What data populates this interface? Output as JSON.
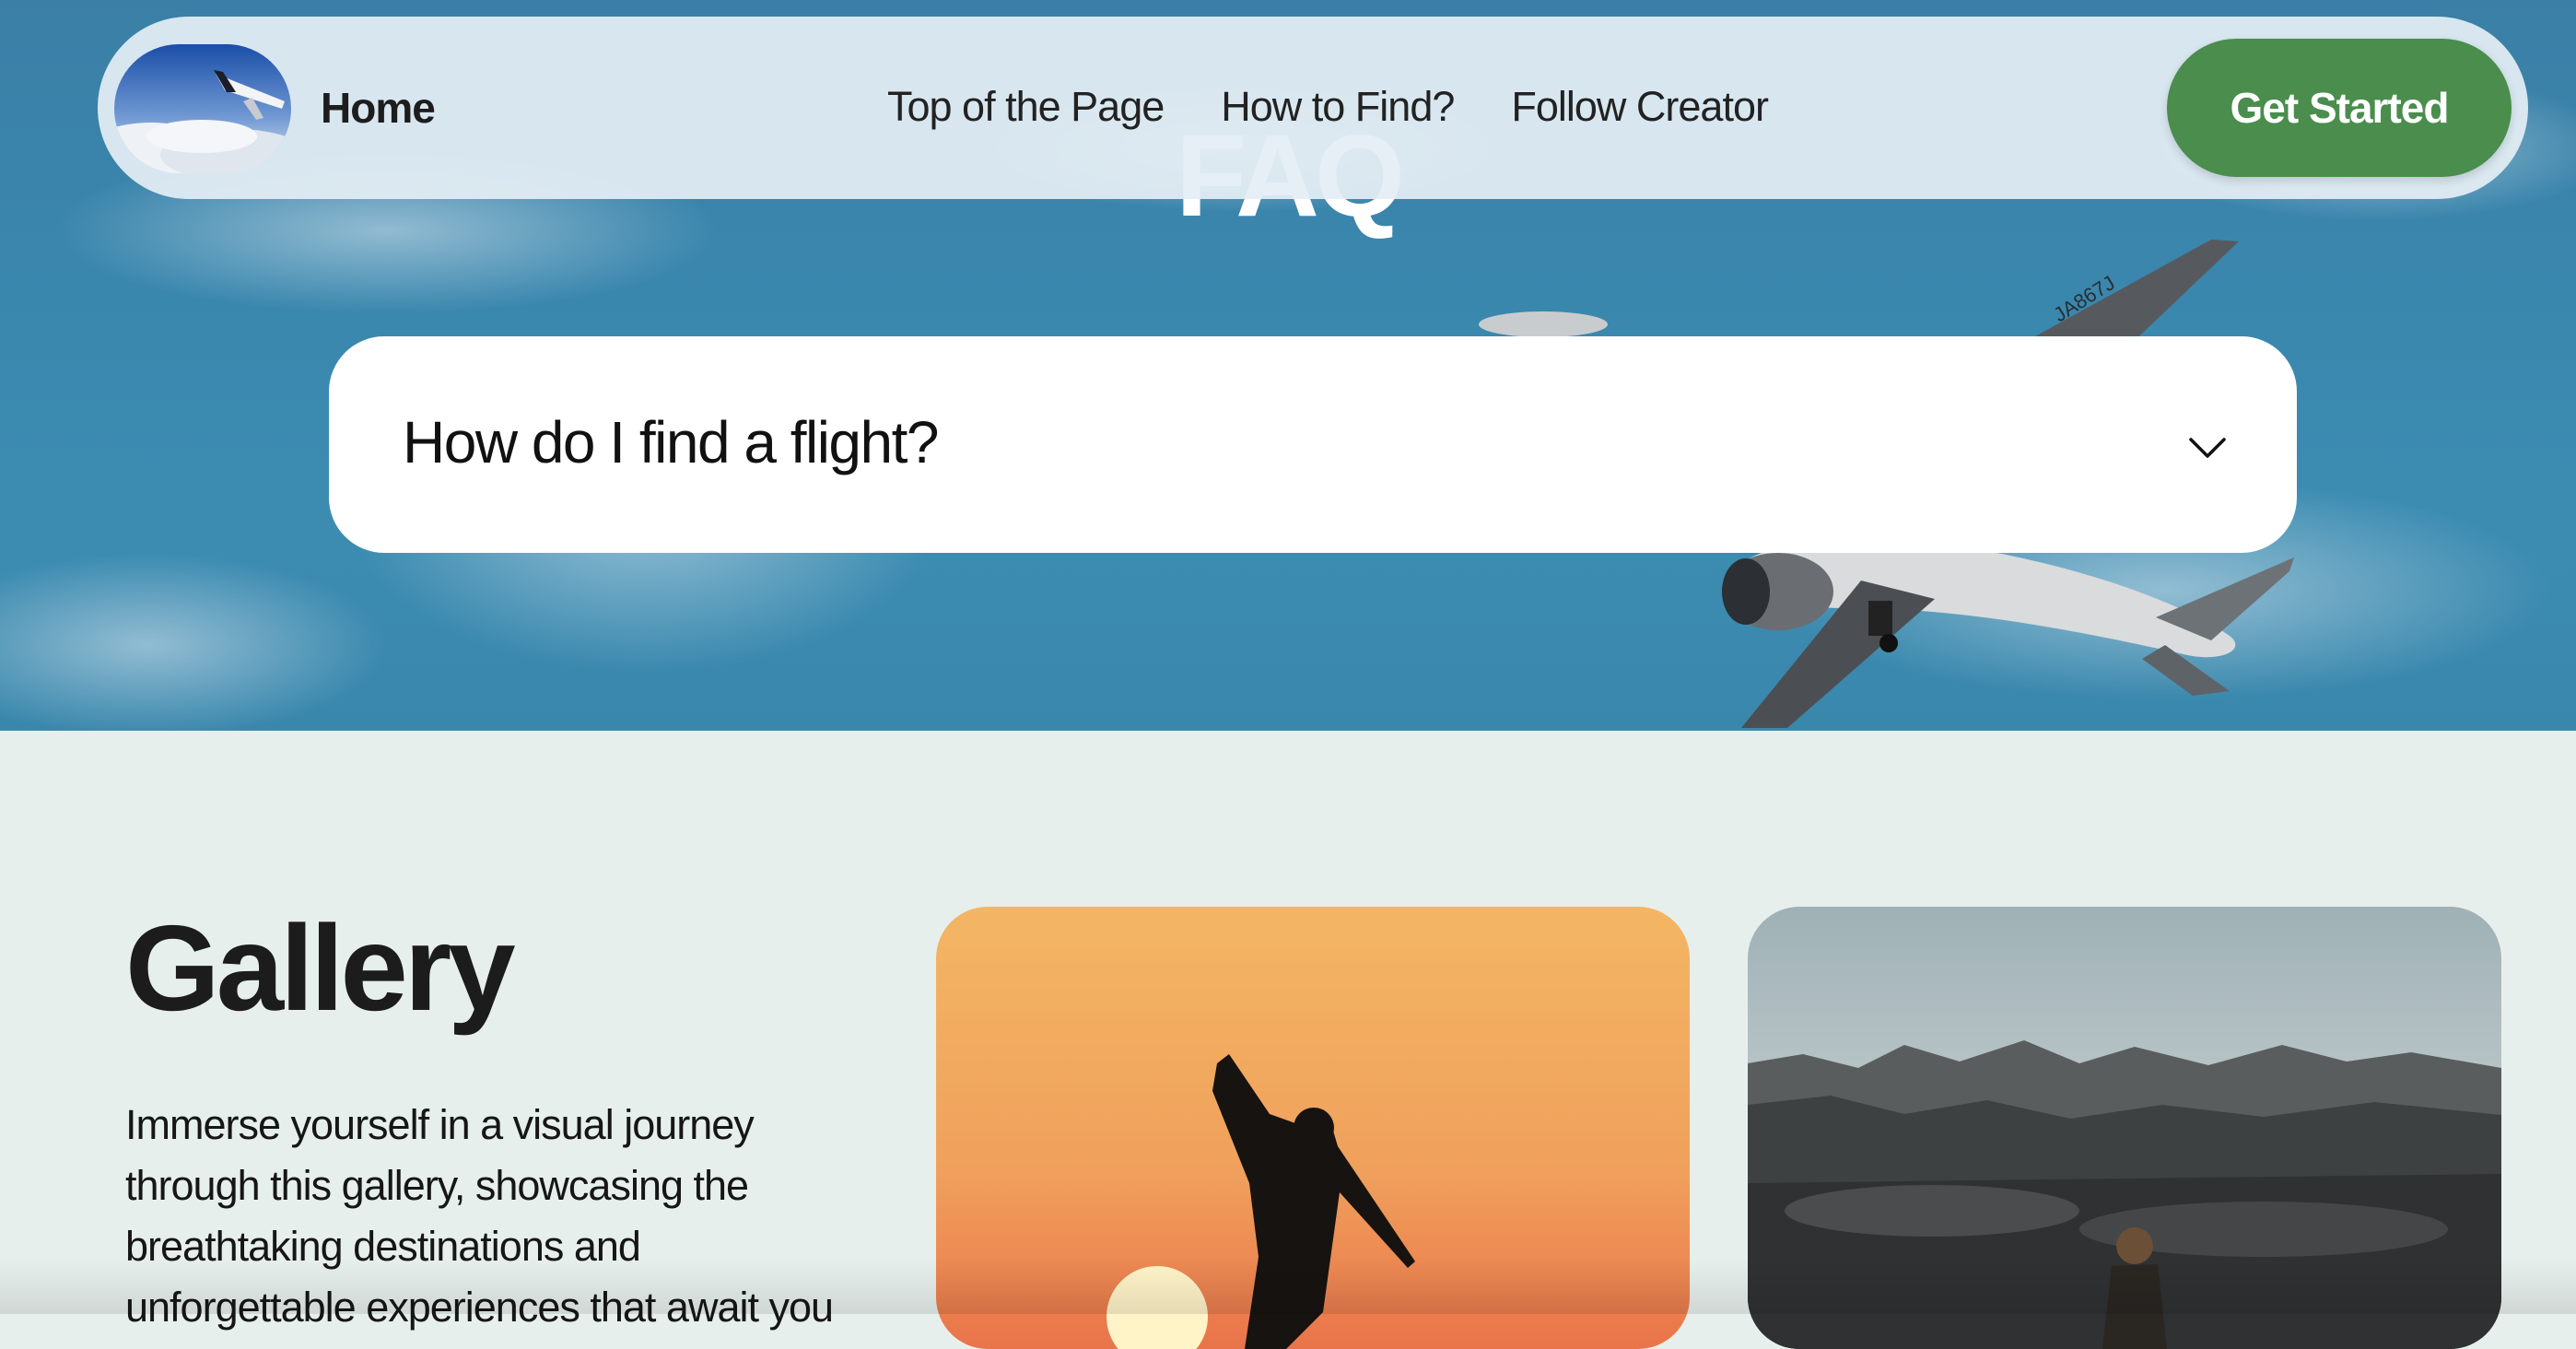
{
  "nav": {
    "home_label": "Home",
    "links": [
      "Top of the Page",
      "How to Find?",
      "Follow Creator"
    ],
    "cta_label": "Get Started"
  },
  "hero": {
    "title": "FAQ",
    "plane_registration": "JA867J"
  },
  "faq": {
    "question": "How do I find a flight?"
  },
  "gallery": {
    "title": "Gallery",
    "description": "Immerse yourself in a visual journey through this gallery, showcasing the breathtaking destinations and unforgettable experiences that await you"
  },
  "colors": {
    "cta": "#4a8d4d",
    "hero_sky": "#3a86ad",
    "page_bg": "#e7efec"
  },
  "icons": {
    "faq_toggle": "chevron-down-icon",
    "logo": "airplane-logo"
  }
}
